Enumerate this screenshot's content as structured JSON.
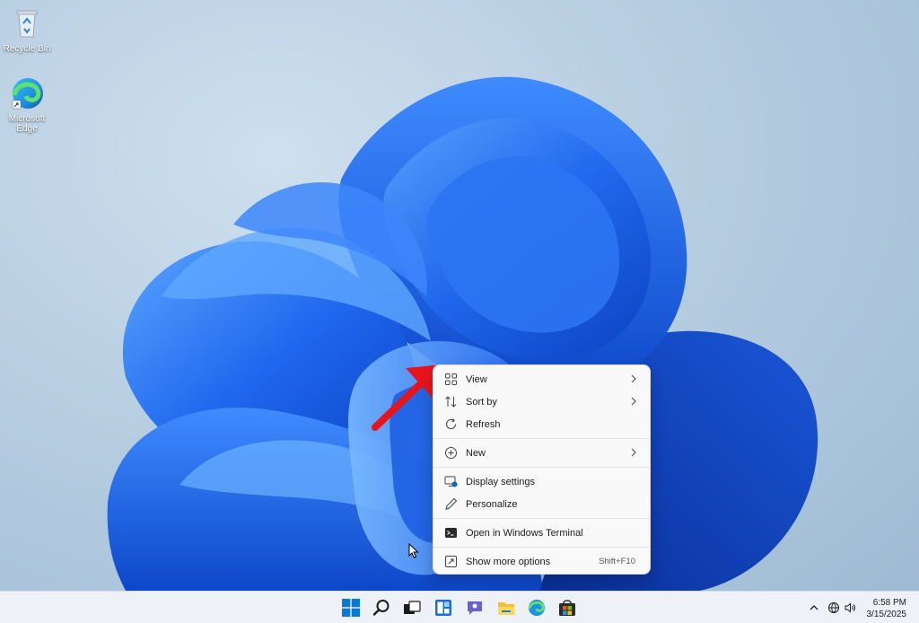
{
  "desktop": {
    "icons": [
      {
        "label": "Recycle Bin"
      },
      {
        "label": "Microsoft Edge"
      }
    ]
  },
  "context_menu": {
    "items": [
      {
        "label": "View",
        "icon": "view-grid-icon",
        "submenu": true
      },
      {
        "label": "Sort by",
        "icon": "sort-icon",
        "submenu": true
      },
      {
        "label": "Refresh",
        "icon": "refresh-icon"
      },
      {
        "label": "New",
        "icon": "new-plus-icon",
        "submenu": true
      },
      {
        "label": "Display settings",
        "icon": "display-icon"
      },
      {
        "label": "Personalize",
        "icon": "pen-icon"
      },
      {
        "label": "Open in Windows Terminal",
        "icon": "terminal-icon"
      },
      {
        "label": "Show more options",
        "icon": "more-options-icon",
        "shortcut": "Shift+F10"
      }
    ]
  },
  "taskbar": {
    "icons": [
      "start-icon",
      "search-icon",
      "task-view-icon",
      "widgets-icon",
      "chat-icon",
      "file-explorer-icon",
      "edge-icon",
      "store-icon"
    ]
  },
  "tray": {
    "icons": [
      "chevron-up-icon",
      "network-icon",
      "volume-icon"
    ],
    "time": "6:58 PM",
    "date": "3/15/2025"
  },
  "colors": {
    "accent": "#0067c0",
    "annotation": "#e8141c",
    "wallpaper_blue": "#1f5ee8"
  }
}
